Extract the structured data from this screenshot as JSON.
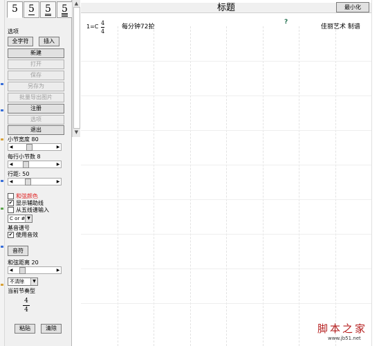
{
  "font_tabs": [
    "5",
    "5",
    "5",
    "5"
  ],
  "panel": {
    "options_label": "选项",
    "full_char_button": "全字符",
    "insert_button": "插入",
    "buttons": [
      {
        "label": "新建",
        "enabled": true
      },
      {
        "label": "打开",
        "enabled": false
      },
      {
        "label": "保存",
        "enabled": false
      },
      {
        "label": "另存为",
        "enabled": false
      },
      {
        "label": "批量导出图片",
        "enabled": false
      },
      {
        "label": "注册",
        "enabled": true
      },
      {
        "label": "选项",
        "enabled": false
      },
      {
        "label": "退出",
        "enabled": true
      }
    ],
    "measure_width_label": "小节宽度 80",
    "measures_per_line_label": "每行小节数 8",
    "line_spacing_label": "行距: 50",
    "sliders": {
      "measure_width": 0.35,
      "measures_per_line": 0.25,
      "line_spacing": 0.3,
      "chord_spacing": 0.15
    },
    "chord_color_label": "和弦颜色",
    "chord_color_text_color": "#e02020",
    "show_guides_label": "显示辅助线",
    "show_guides_checked": true,
    "from_staff_input_label": "从五线谱输入",
    "from_staff_input_checked": false,
    "key_select_value": "C or #C",
    "pitch_label_label": "基音谱号",
    "use_audio_label": "使用音效",
    "use_audio_checked": true,
    "note_button": "音符",
    "chord_spacing_label": "和弦距离 20",
    "clear_select_value": "不清除",
    "current_meter_label": "当前节奏型",
    "meter_num": "4",
    "meter_den": "4",
    "paste_button": "粘贴",
    "clear_button": "清除"
  },
  "score": {
    "title": "标题",
    "minimize_button": "最小化",
    "key": "1=C",
    "time_num": "4",
    "time_den": "4",
    "tempo": "每分钟72拍",
    "qmark": "?",
    "credit": "佳丽艺术 制谱"
  },
  "watermark": {
    "logo": "脚本之家",
    "url": "www.jb51.net"
  }
}
